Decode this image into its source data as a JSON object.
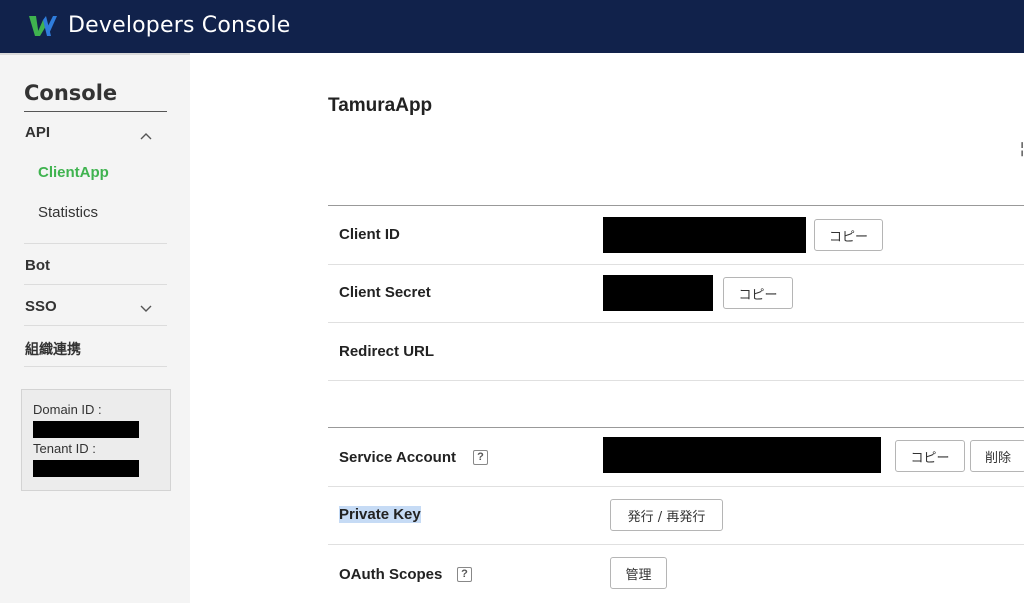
{
  "header": {
    "app_title": "Developers Console",
    "colors": {
      "bar": "#11224b",
      "logo_green": "#3fb34f",
      "logo_blue": "#2f7ddc"
    }
  },
  "sidebar": {
    "title": "Console",
    "items": [
      {
        "label": "API",
        "expanded": true,
        "icon": "chevron-up-icon",
        "children": [
          {
            "label": "ClientApp",
            "active": true
          },
          {
            "label": "Statistics",
            "active": false
          }
        ]
      },
      {
        "label": "Bot"
      },
      {
        "label": "SSO",
        "expanded": false,
        "icon": "chevron-down-icon"
      },
      {
        "label": "組織連携"
      }
    ],
    "ids": {
      "domain_label": "Domain ID :",
      "tenant_label": "Tenant ID :"
    },
    "active_color": "#3fb34f"
  },
  "main": {
    "title": "TamuraApp",
    "rows": {
      "client_id": {
        "label": "Client ID",
        "copy": "コピー"
      },
      "client_secret": {
        "label": "Client Secret",
        "copy": "コピー"
      },
      "redirect_url": {
        "label": "Redirect URL"
      },
      "service_account": {
        "label": "Service Account",
        "help": "?",
        "copy": "コピー",
        "delete": "削除"
      },
      "private_key": {
        "label": "Private Key",
        "issue": "発行 / 再発行"
      },
      "oauth_scopes": {
        "label": "OAuth Scopes",
        "help": "?",
        "manage": "管理"
      }
    }
  }
}
